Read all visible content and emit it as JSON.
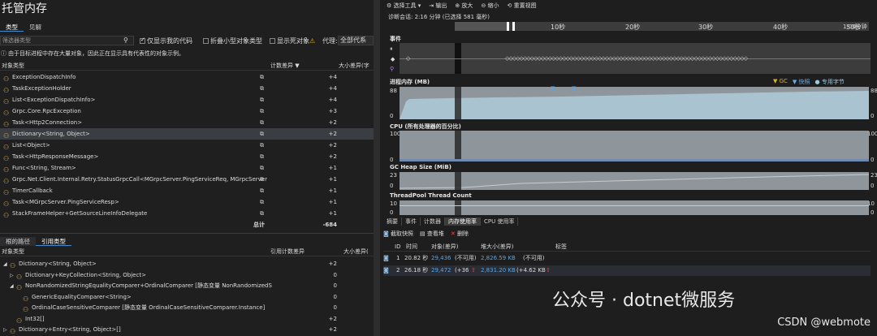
{
  "left": {
    "title": "托管内存",
    "tabs": [
      "类型",
      "见解"
    ],
    "filter_placeholder": "筛选器类型",
    "only_mine_label": "仅显示我的代码",
    "collapse_small_label": "折叠小型对象类型",
    "show_dead_label": "显示死对象",
    "agent_label": "代理:",
    "agent_value": "全部代系",
    "notice": "由于目标进程中存在大量对象，因此正在显示具有代表性的对象示例。",
    "columns": {
      "type": "对象类型",
      "count_diff": "计数差异 ▼",
      "size_diff": "大小差异(字"
    },
    "rows": [
      {
        "name": "ExceptionDispatchInfo",
        "diff": "+4"
      },
      {
        "name": "TaskExceptionHolder",
        "diff": "+4"
      },
      {
        "name": "List<ExceptionDispatchInfo>",
        "diff": "+4"
      },
      {
        "name": "Grpc.Core.RpcException",
        "diff": "+3"
      },
      {
        "name": "Task<Http2Connection>",
        "diff": "+2"
      },
      {
        "name": "Dictionary<String, Object>",
        "diff": "+2"
      },
      {
        "name": "List<Object>",
        "diff": "+2"
      },
      {
        "name": "Task<HttpResponseMessage>",
        "diff": "+2"
      },
      {
        "name": "Func<String, Stream>",
        "diff": "+1"
      },
      {
        "name": "Grpc.Net.Client.Internal.Retry.StatusGrpcCall<MGrpcServer.PingServiceReq, MGrpcServer",
        "diff": "+1"
      },
      {
        "name": "TimerCallback",
        "diff": "+1"
      },
      {
        "name": "Task<MGrpcServer.PingServiceResp>",
        "diff": "+1"
      },
      {
        "name": "StackFrameHelper+GetSourceLineInfoDelegate",
        "diff": "+1"
      }
    ],
    "total_label": "总计",
    "total_value": "-684",
    "bottom_tabs": [
      "根的路径",
      "引用类型"
    ],
    "bottom_columns": {
      "type": "对象类型",
      "ref_diff": "引用计数差异",
      "size": "大小差异("
    },
    "bottom_rows": [
      {
        "indent": 0,
        "prefix": "◢",
        "name": "Dictionary<String, Object>",
        "diff": "+2"
      },
      {
        "indent": 1,
        "prefix": "▷",
        "name": "Dictionary+KeyCollection<String, Object>",
        "diff": "0"
      },
      {
        "indent": 1,
        "prefix": "◢",
        "name": "NonRandomizedStringEqualityComparer+OrdinalComparer [静态变量 NonRandomizedS",
        "diff": "0"
      },
      {
        "indent": 2,
        "prefix": "",
        "name": "GenericEqualityComparer<String>",
        "diff": "0"
      },
      {
        "indent": 2,
        "prefix": "",
        "name": "OrdinalCaseSensitiveComparer [静态变量 OrdinalCaseSensitiveComparer.Instance]",
        "diff": "0"
      },
      {
        "indent": 1,
        "prefix": "",
        "name": "Int32[]",
        "diff": "+2"
      },
      {
        "indent": 0,
        "prefix": "▷",
        "name": "Dictionary+Entry<String, Object>[]",
        "diff": "+2"
      }
    ]
  },
  "right": {
    "toolbar": [
      "⚙ 选择工具 ▾",
      "⇥ 输出",
      "⊕ 放大",
      "⊖ 缩小",
      "⟲ 重置视图"
    ],
    "session": "诊断会话: 2:16 分钟 (已选择 581 毫秒)",
    "ticks": [
      "10秒",
      "20秒",
      "30秒",
      "40秒",
      "50秒",
      "1:00分钟"
    ],
    "events_label": "事件",
    "mem_label": "进程内存 (MB)",
    "mem_legend": [
      "▼ GC",
      "▼ 快照",
      "● 专用字节"
    ],
    "mem_max": "88",
    "mem_min": "0",
    "cpu_label": "CPU (所有处理器的百分比)",
    "cpu_max": "100",
    "cpu_min": "0",
    "gc_label": "GC Heap Size (MiB)",
    "gc_max": "23",
    "gc_min": "0",
    "tp_label": "ThreadPool Thread Count",
    "tp_max": "10",
    "tp_min": "0",
    "panel_tabs": [
      "摘要",
      "事件",
      "计数器",
      "内存使用率",
      "CPU 使用率"
    ],
    "snap_tools": [
      "截取快照",
      "查看堆",
      "删除"
    ],
    "snap_cols": [
      "ID",
      "时间",
      "对象(差异)",
      "堆大小(差异)",
      "标签"
    ],
    "snapshots": [
      {
        "id": "1",
        "time": "20.82 秒",
        "objects": "29,436",
        "objects_diff": "(不可用)",
        "heap": "2,826.59 KB",
        "heap_diff": "(不可用)"
      },
      {
        "id": "2",
        "time": "26.18 秒",
        "objects": "29,472",
        "objects_diff": "(+36",
        "heap": "2,831.20 KB",
        "heap_diff": "(+4.62 KB"
      }
    ]
  },
  "watermark": "公众号 · dotnet微服务",
  "csdn": "CSDN @webmote"
}
